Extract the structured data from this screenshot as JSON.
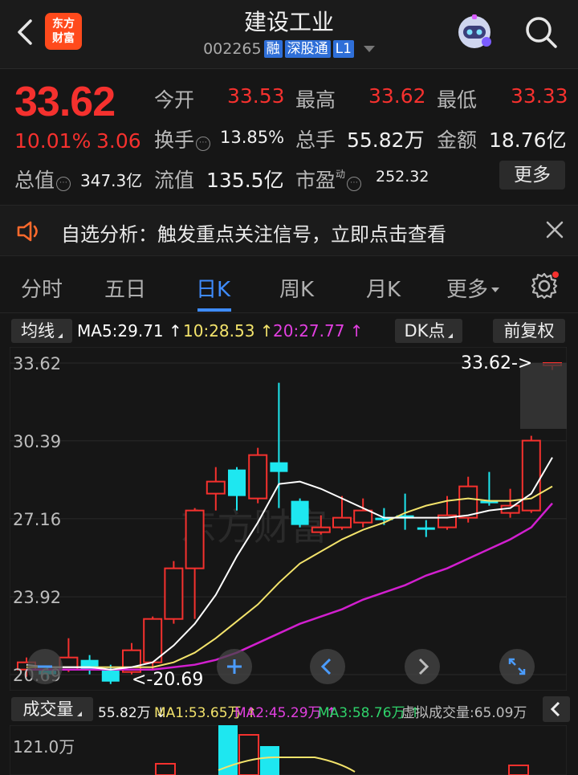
{
  "header": {
    "title": "建设工业",
    "code": "002265",
    "tags": [
      "融",
      "深股通",
      "L1"
    ],
    "logo": "东方\n财富"
  },
  "quote": {
    "price": "33.62",
    "change_pct": "10.01%",
    "change": "3.06",
    "open_label": "今开",
    "open": "33.53",
    "high_label": "最高",
    "high": "33.62",
    "low_label": "最低",
    "low": "33.33",
    "turnover_label": "换手",
    "turnover": "13.85%",
    "volume_label": "总手",
    "volume": "55.82万",
    "amount_label": "金额",
    "amount": "18.76亿",
    "mcap_label": "总值",
    "mcap": "347.3亿",
    "float_label": "流值",
    "float_mcap": "135.5亿",
    "pe_label": "市盈",
    "pe_sup": "动",
    "pe": "252.32",
    "more_label": "更多"
  },
  "notice": {
    "text": "自选分析：触发重点关注信号，立即点击查看"
  },
  "tabs": [
    "分时",
    "五日",
    "日K",
    "周K",
    "月K",
    "更多"
  ],
  "active_tab": "日K",
  "indicators": {
    "ma_button": "均线",
    "ma5": "MA5:29.71",
    "ma10": "10:28.53",
    "ma20": "20:27.77",
    "dk_button": "DK点",
    "adjust_button": "前复权"
  },
  "chart_labels": {
    "y_ticks": [
      "33.62",
      "30.39",
      "27.16",
      "23.92",
      "20.69"
    ],
    "last_price_label": "33.62->",
    "low_marker_label": "<-20.69"
  },
  "volume": {
    "button": "成交量",
    "total": "55.82万",
    "ma1": "MA1:53.65万",
    "ma2": "MA2:45.29万",
    "ma3": "MA3:58.76万",
    "virtual": "虚拟成交量:65.09万",
    "y_tick": "121.0万"
  },
  "colors": {
    "up": "#f5312e",
    "down": "#1ee7f0",
    "ma5": "#ffffff",
    "ma10": "#f3e36b",
    "ma20": "#d21fcf",
    "accent": "#3f8cff"
  },
  "chart_data": {
    "type": "candlestick",
    "ylim": [
      20.69,
      33.62
    ],
    "y_ticks": [
      33.62,
      30.39,
      27.16,
      23.92,
      20.69
    ],
    "candles": [
      {
        "o": 21.2,
        "c": 20.9,
        "h": 21.4,
        "l": 20.6,
        "dir": "up"
      },
      {
        "o": 20.9,
        "c": 20.7,
        "h": 21.0,
        "l": 20.5,
        "dir": "down"
      },
      {
        "o": 20.9,
        "c": 21.4,
        "h": 22.2,
        "l": 20.8,
        "dir": "up"
      },
      {
        "o": 21.3,
        "c": 20.9,
        "h": 21.5,
        "l": 20.7,
        "dir": "down"
      },
      {
        "o": 20.9,
        "c": 20.4,
        "h": 21.1,
        "l": 20.3,
        "dir": "down"
      },
      {
        "o": 20.8,
        "c": 21.7,
        "h": 22.0,
        "l": 20.7,
        "dir": "up"
      },
      {
        "o": 21.2,
        "c": 23.0,
        "h": 23.1,
        "l": 20.9,
        "dir": "up"
      },
      {
        "o": 23.0,
        "c": 25.1,
        "h": 25.4,
        "l": 22.8,
        "dir": "up"
      },
      {
        "o": 25.1,
        "c": 27.5,
        "h": 27.6,
        "l": 23.0,
        "dir": "up"
      },
      {
        "o": 28.2,
        "c": 28.7,
        "h": 29.3,
        "l": 27.5,
        "dir": "up"
      },
      {
        "o": 29.2,
        "c": 28.1,
        "h": 29.3,
        "l": 27.5,
        "dir": "down"
      },
      {
        "o": 28.0,
        "c": 29.8,
        "h": 30.1,
        "l": 27.8,
        "dir": "up"
      },
      {
        "o": 29.5,
        "c": 29.1,
        "h": 32.8,
        "l": 27.6,
        "dir": "down"
      },
      {
        "o": 27.9,
        "c": 26.9,
        "h": 28.0,
        "l": 26.8,
        "dir": "down"
      },
      {
        "o": 26.6,
        "c": 26.8,
        "h": 27.3,
        "l": 26.5,
        "dir": "up"
      },
      {
        "o": 26.8,
        "c": 27.2,
        "h": 28.1,
        "l": 26.7,
        "dir": "up"
      },
      {
        "o": 27.0,
        "c": 27.5,
        "h": 28.0,
        "l": 26.8,
        "dir": "up"
      },
      {
        "o": 27.2,
        "c": 27.1,
        "h": 27.6,
        "l": 26.9,
        "dir": "down"
      },
      {
        "o": 27.3,
        "c": 27.2,
        "h": 28.2,
        "l": 26.7,
        "dir": "down"
      },
      {
        "o": 26.8,
        "c": 26.8,
        "h": 27.1,
        "l": 26.4,
        "dir": "down"
      },
      {
        "o": 26.8,
        "c": 27.3,
        "h": 28.1,
        "l": 26.7,
        "dir": "up"
      },
      {
        "o": 27.2,
        "c": 28.5,
        "h": 28.9,
        "l": 27.0,
        "dir": "up"
      },
      {
        "o": 27.8,
        "c": 27.9,
        "h": 29.1,
        "l": 27.7,
        "dir": "down"
      },
      {
        "o": 27.4,
        "c": 27.7,
        "h": 28.4,
        "l": 27.2,
        "dir": "up"
      },
      {
        "o": 27.5,
        "c": 30.4,
        "h": 30.6,
        "l": 27.4,
        "dir": "up"
      },
      {
        "o": 33.53,
        "c": 33.62,
        "h": 33.62,
        "l": 33.33,
        "dir": "up"
      }
    ],
    "ma5": [
      21.1,
      21.0,
      21.0,
      21.0,
      20.9,
      21.0,
      21.2,
      21.9,
      22.8,
      24.0,
      25.6,
      27.0,
      28.6,
      28.7,
      28.4,
      28.0,
      27.6,
      27.2,
      27.2,
      27.2,
      27.2,
      27.3,
      27.5,
      27.6,
      28.2,
      29.7
    ],
    "ma10": [
      21.0,
      21.0,
      21.0,
      21.0,
      21.0,
      21.0,
      21.0,
      21.2,
      21.6,
      22.2,
      22.9,
      23.6,
      24.5,
      25.3,
      25.8,
      26.3,
      26.7,
      27.0,
      27.4,
      27.7,
      27.9,
      28.0,
      27.9,
      27.9,
      28.0,
      28.5
    ],
    "ma20": [
      20.9,
      20.9,
      20.9,
      20.9,
      20.9,
      20.9,
      20.9,
      21.0,
      21.1,
      21.3,
      21.6,
      22.0,
      22.4,
      22.8,
      23.1,
      23.4,
      23.8,
      24.1,
      24.4,
      24.8,
      25.1,
      25.5,
      25.9,
      26.3,
      26.8,
      27.8
    ]
  }
}
